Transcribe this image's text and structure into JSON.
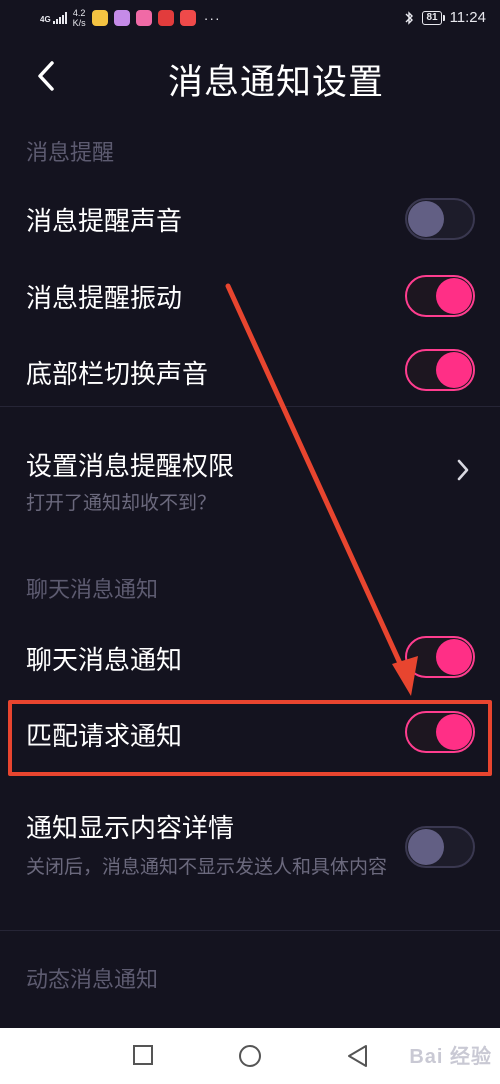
{
  "status_bar": {
    "network": "4G",
    "speed_top": "4.2",
    "speed_bottom": "K/s",
    "overflow": "···",
    "battery": "81",
    "time": "11:24"
  },
  "header": {
    "title": "消息通知设置"
  },
  "sections": {
    "reminder": {
      "title": "消息提醒",
      "rows": [
        {
          "label": "消息提醒声音",
          "state": "off"
        },
        {
          "label": "消息提醒振动",
          "state": "on"
        },
        {
          "label": "底部栏切换声音",
          "state": "on"
        }
      ]
    },
    "permission": {
      "label": "设置消息提醒权限",
      "desc": "打开了通知却收不到？"
    },
    "chat": {
      "title": "聊天消息通知",
      "rows": [
        {
          "label": "聊天消息通知",
          "state": "on"
        },
        {
          "label": "匹配请求通知",
          "state": "on"
        },
        {
          "label": "通知显示内容详情",
          "state": "off",
          "desc": "关闭后，消息通知不显示发送人和具体内容"
        }
      ]
    },
    "dynamic": {
      "title": "动态消息通知"
    }
  },
  "colors": {
    "background": "#14131f",
    "toggle_on": "#ff2f86",
    "toggle_off_knob": "#625f84",
    "annotation": "#e8452f"
  },
  "nav_bar": {
    "watermark": "Bai 经验"
  }
}
